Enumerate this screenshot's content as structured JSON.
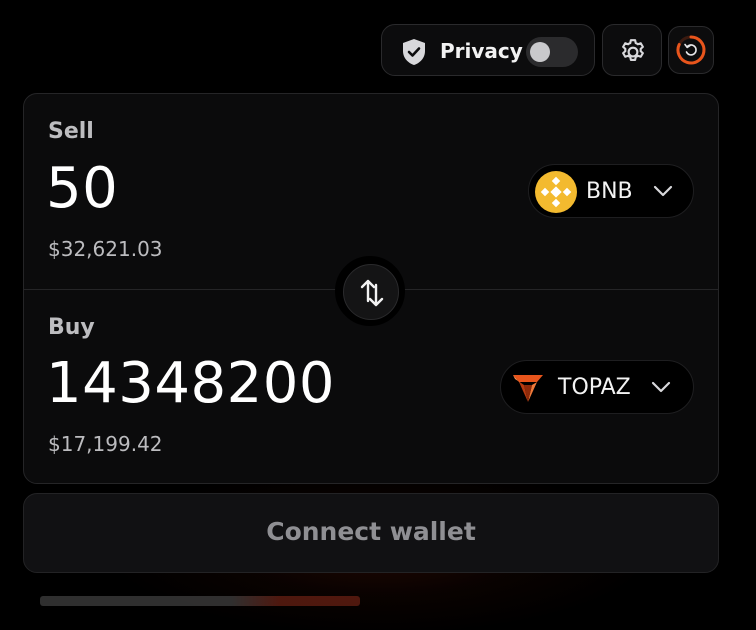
{
  "header": {
    "privacy_label": "Privacy",
    "privacy_enabled": false,
    "icons": {
      "privacy": "shield-check-icon",
      "settings": "gear-icon",
      "refresh": "refresh-timer-icon"
    }
  },
  "sell": {
    "label": "Sell",
    "amount": "50",
    "usd_value": "$32,621.03",
    "token": {
      "symbol": "BNB",
      "icon": "bnb-logo-icon",
      "color": "#F3BA2F"
    }
  },
  "buy": {
    "label": "Buy",
    "amount": "14348200",
    "usd_value": "$17,199.42",
    "token": {
      "symbol": "TOPAZ",
      "icon": "topaz-logo-icon",
      "color": "#E8551C"
    }
  },
  "swap_direction_icon": "swap-arrows-icon",
  "connect_wallet_label": "Connect wallet",
  "colors": {
    "background": "#000000",
    "card": "#0b0b0c",
    "accent": "#E8551C"
  }
}
